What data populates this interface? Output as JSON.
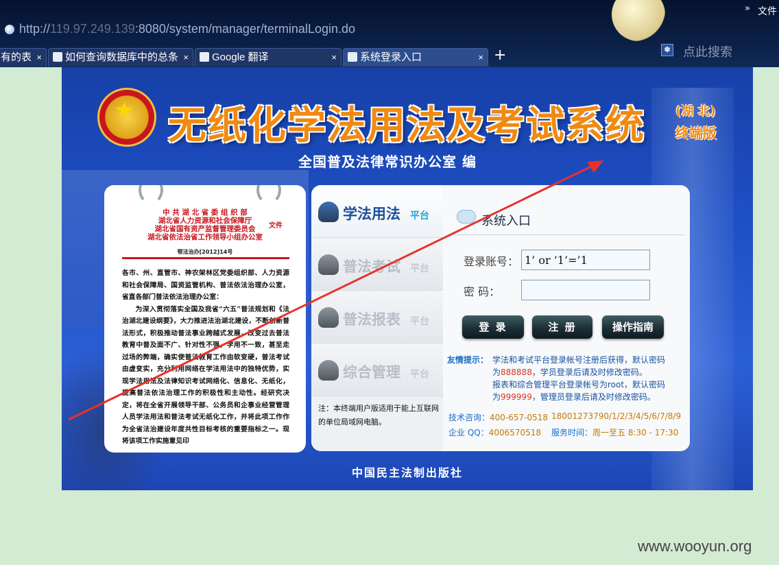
{
  "browser": {
    "menu_more": "»",
    "menu_file": "文件",
    "url_prefix": "http://",
    "url_host": "119.97.249.139",
    "url_rest": ":8080/system/manager/terminalLogin.do",
    "search_placeholder": "点此搜索",
    "tabs": [
      {
        "label": "有的表",
        "close": "×",
        "active": false
      },
      {
        "label": "如何查询数据库中的总条",
        "close": "×",
        "active": false
      },
      {
        "label": "Google 翻译",
        "close": "×",
        "active": false
      },
      {
        "label": "系统登录入口",
        "close": "×",
        "active": true
      }
    ],
    "new_tab": "+"
  },
  "page": {
    "title": "无纸化学法用法及考试系统",
    "region": "(湖 北)",
    "edition": "终端版",
    "editor": "全国普及法律常识办公室  编",
    "publisher": "中国民主法制出版社"
  },
  "document": {
    "issuer_lines": [
      "中 共 湖 北 省 委 组 织 部",
      "湖北省人力资源和社会保障厅",
      "湖北省国有资产监督管理委员会",
      "湖北省依法治省工作领导小组办公室"
    ],
    "file_word": "文件",
    "doc_number": "鄂法治办[2012]14号",
    "paragraph1": "各市、州、直管市、神农架林区党委组织部、人力资源和社会保障局、国资监管机构、普法依法治理办公室，省直各部门普法依法治理办公室：",
    "paragraph2": "为深入贯彻落实全国及我省“六五”普法规划和《法治湖北建设纲要》，大力推进法治湖北建设，不断创新普法形式，积极推动普法事业跨越式发展，改变过去普法教育中普及面不广、针对性不强，学用不一致，甚至走过场的弊端，确实使普法教育工作由软变硬，普法考试由虚变实，充分利用网络在学法用法中的独特优势，实现学法用法及法律知识考试网络化、信息化、无纸化，提高普法依法治理工作的积极性和主动性。经研究决定，将在全省开展领导干部、公务员和企事业经营管理人员学法用法和普法考试无纸化工作，并将此项工作作为全省法治建设年度共性目标考核的重要指标之一。现将该项工作实施意见印"
  },
  "nav": [
    {
      "label": "学法用法",
      "suffix": "平台",
      "active": true
    },
    {
      "label": "普法考试",
      "suffix": "平台",
      "active": false
    },
    {
      "label": "普法报表",
      "suffix": "平台",
      "active": false
    },
    {
      "label": "综合管理",
      "suffix": "平台",
      "active": false
    }
  ],
  "nav_note": "注：本终端用户版适用于能上互联网的单位局域网电脑。",
  "login": {
    "title": "系统入口",
    "account_label": "登录账号：",
    "account_value": "1’ or ’1’=’1",
    "password_label": "密    码：",
    "password_value": "",
    "login_button": "登 录",
    "register_button": "注 册",
    "guide_button": "操作指南"
  },
  "tip": {
    "label": "友情提示：",
    "line1": "学法和考试平台登录帐号注册后获得，默认密码",
    "line2_pre": "为",
    "pwd1": "888888",
    "line2_post": "，学员登录后请及时修改密码。",
    "line3": "报表和综合管理平台登录帐号为root，默认密码",
    "line4_pre": "为",
    "pwd2": "999999",
    "line4_post": "，管理员登录后请及时修改密码。"
  },
  "contact": {
    "tech_label": "技术咨询：",
    "tech_value": "400-657-0518",
    "phones": "18001273790/1/2/3/4/5/6/7/8/9",
    "qq_label": "企业 QQ：",
    "qq_value": "4006570518",
    "hours_label": "服务时间：",
    "hours_value": "周一至五 8:30 - 17:30"
  },
  "watermark": "www.wooyun.org",
  "colors": {
    "arrow": "#e8312a",
    "title_orange": "#f08a12",
    "accent_blue": "#1a52a0"
  }
}
